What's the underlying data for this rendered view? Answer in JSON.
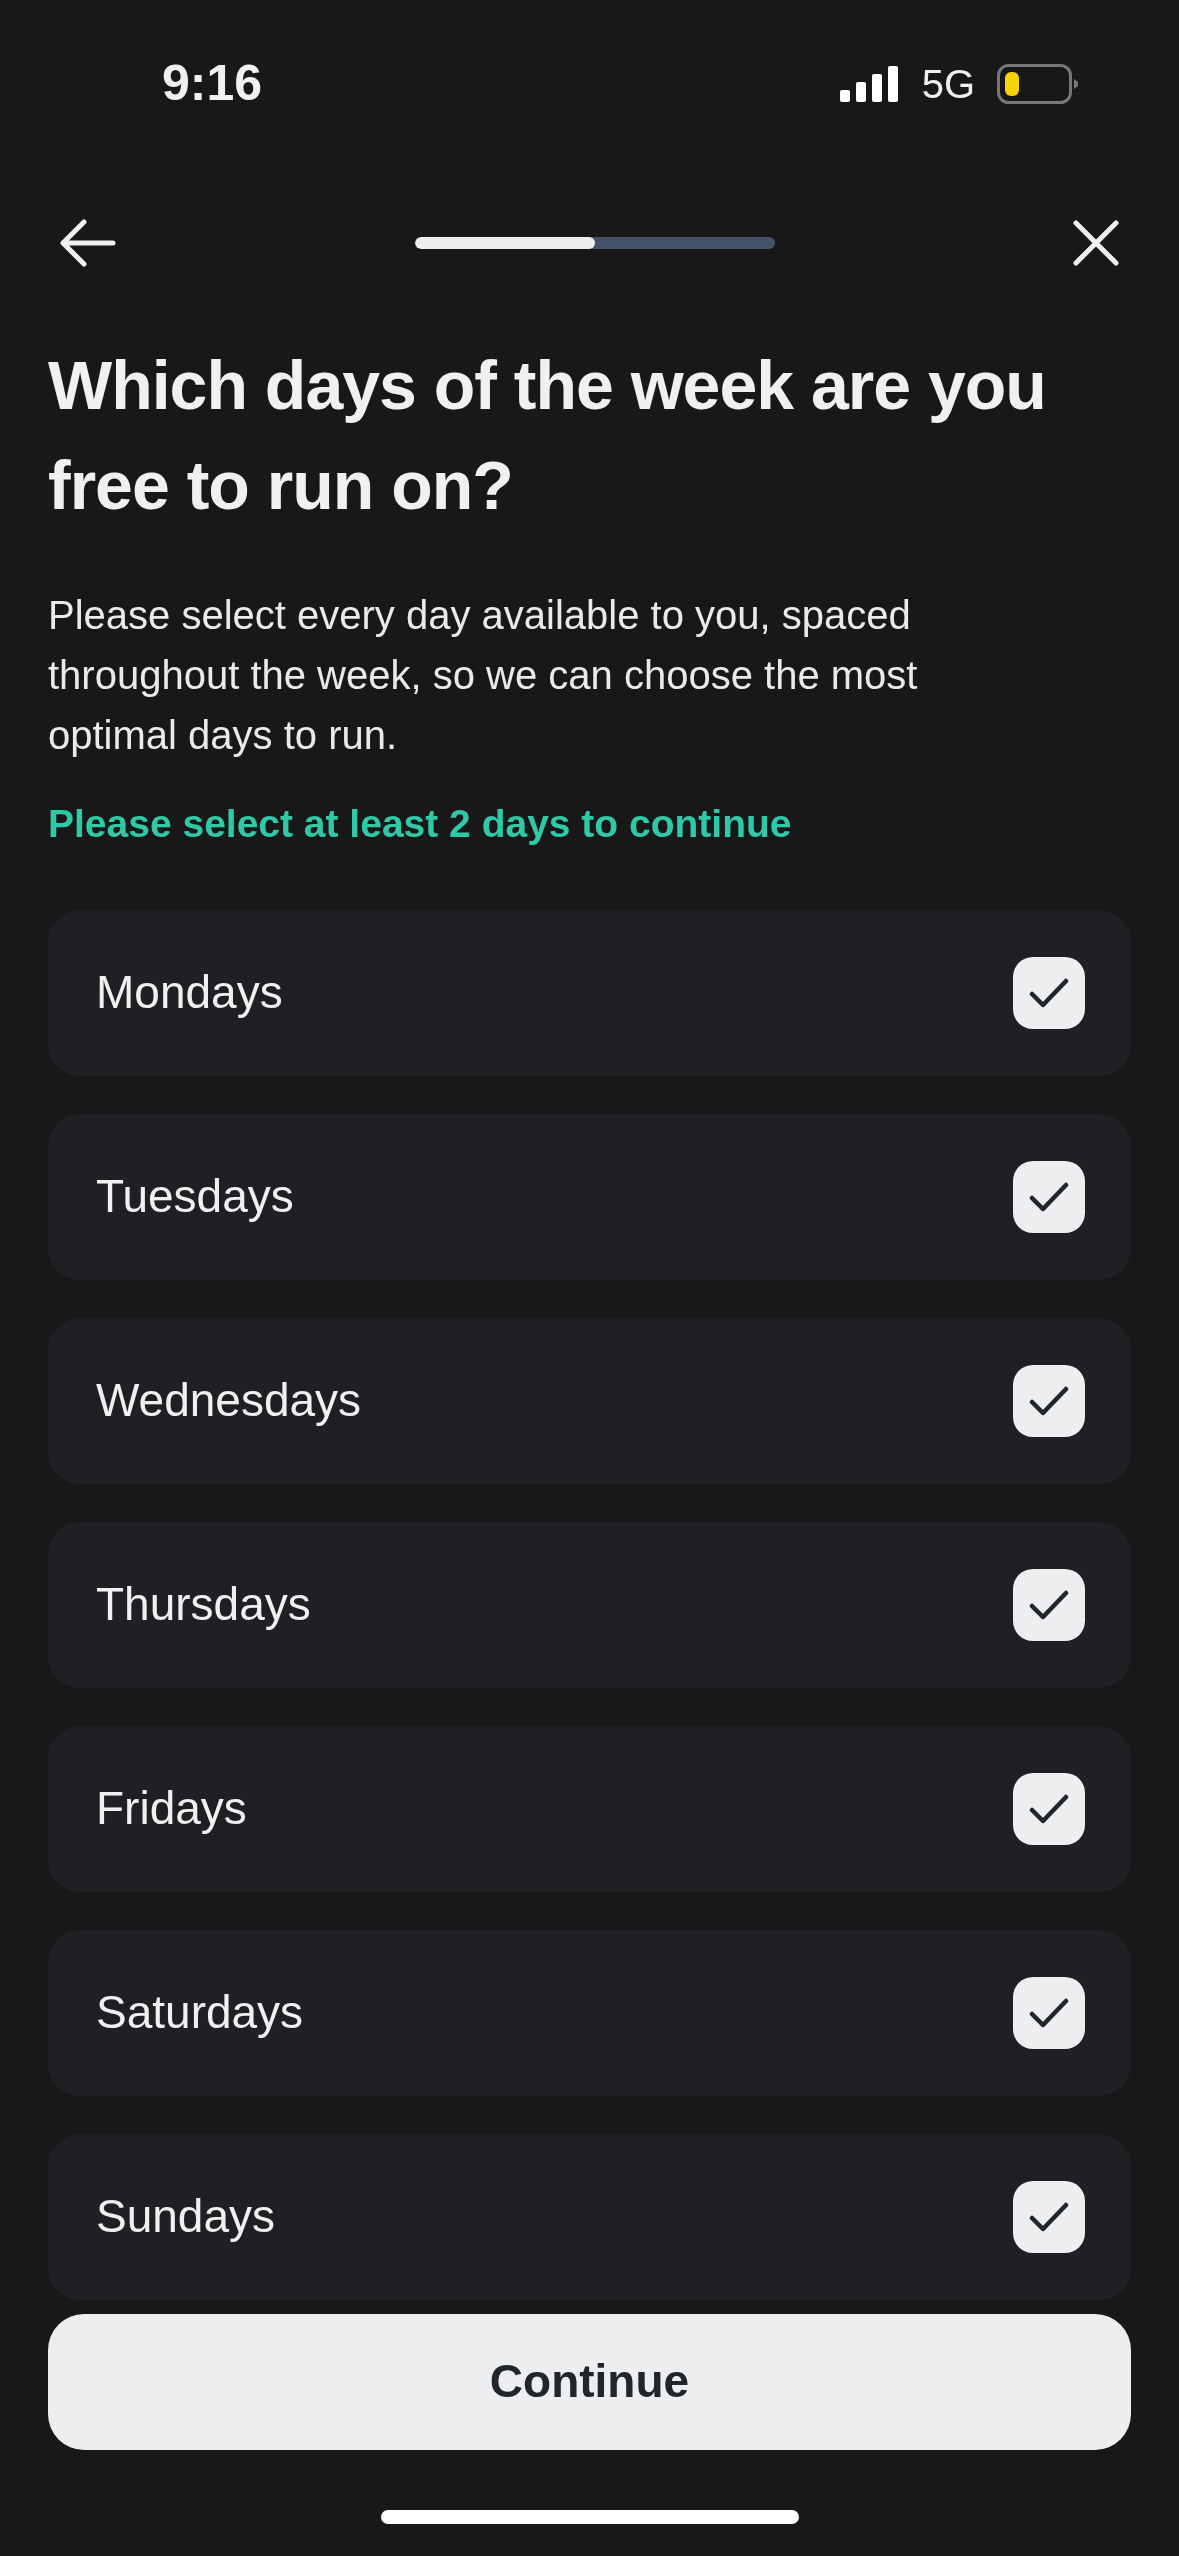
{
  "status_bar": {
    "time": "9:16",
    "network": "5G"
  },
  "progress": {
    "level": 0.5
  },
  "title": "Which days of the week are you free to run on?",
  "description": "Please select every day available to you, spaced throughout the week, so we can choose the most optimal days to run.",
  "hint": "Please select at least 2 days to continue",
  "days": [
    {
      "label": "Mondays",
      "checked": true
    },
    {
      "label": "Tuesdays",
      "checked": true
    },
    {
      "label": "Wednesdays",
      "checked": true
    },
    {
      "label": "Thursdays",
      "checked": true
    },
    {
      "label": "Fridays",
      "checked": true
    },
    {
      "label": "Saturdays",
      "checked": true
    },
    {
      "label": "Sundays",
      "checked": true
    }
  ],
  "continue_button": "Continue"
}
